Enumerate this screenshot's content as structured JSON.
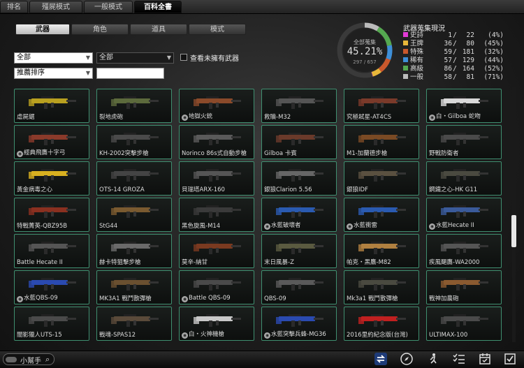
{
  "top_tabs": [
    "排名",
    "殭屍模式",
    "一般模式",
    "百科全書"
  ],
  "category_tabs": [
    "武器",
    "角色",
    "道具",
    "模式"
  ],
  "filters": {
    "type_select": "全部",
    "sub_select": "全部",
    "sort_select": "推薦排序",
    "search_placeholder": "",
    "show_unowned_label": "查看未擁有武器"
  },
  "collection": {
    "gauge_title": "全部蒐集",
    "percent_text": "45.21%",
    "count_text": "297 / 657",
    "percent_value": 0.4521,
    "stats_title": "武器蒐集現況",
    "rows": [
      {
        "label": "史詩",
        "owned": "1",
        "total": "22",
        "pct": "(4%)",
        "color": "#e23ad6"
      },
      {
        "label": "王牌",
        "owned": "36",
        "total": "80",
        "pct": "(45%)",
        "color": "#e8b73a"
      },
      {
        "label": "特殊",
        "owned": "59",
        "total": "181",
        "pct": "(32%)",
        "color": "#c9582c"
      },
      {
        "label": "稀有",
        "owned": "57",
        "total": "129",
        "pct": "(44%)",
        "color": "#3e8fd8"
      },
      {
        "label": "高級",
        "owned": "86",
        "total": "164",
        "pct": "(52%)",
        "color": "#55a850"
      },
      {
        "label": "一般",
        "owned": "58",
        "total": "81",
        "pct": "(71%)",
        "color": "#bbbbbb"
      }
    ]
  },
  "weapons": [
    {
      "name": "虐屍鋸",
      "badge": false,
      "color": "#b8a020"
    },
    {
      "name": "裂地虎砲",
      "badge": false,
      "color": "#5c6a3c"
    },
    {
      "name": "地獄火銃",
      "badge": true,
      "color": "#8a4a2a"
    },
    {
      "name": "救贖-M32",
      "badge": false,
      "color": "#555555"
    },
    {
      "name": "究極弒星-AT4CS",
      "badge": false,
      "color": "#7a3a2a"
    },
    {
      "name": "白・Gilboa 蛇吻",
      "badge": true,
      "color": "#d8d8d8"
    },
    {
      "name": "經典飛鷹十字弓",
      "badge": true,
      "color": "#8a3a2a"
    },
    {
      "name": "KH-2002突擊步槍",
      "badge": false,
      "color": "#4a4a4a"
    },
    {
      "name": "Norinco 86s式自動步槍",
      "badge": false,
      "color": "#5a5a5a"
    },
    {
      "name": "Gilboa 卡賓",
      "badge": false,
      "color": "#6a3a2a"
    },
    {
      "name": "M1-加蘭德步槍",
      "badge": false,
      "color": "#7a4a24"
    },
    {
      "name": "野戰防衛者",
      "badge": false,
      "color": "#4a4a4a"
    },
    {
      "name": "黃金病毒之心",
      "badge": false,
      "color": "#d8b020"
    },
    {
      "name": "OTS-14 GROZA",
      "badge": false,
      "color": "#444444"
    },
    {
      "name": "貝瑞塔ARX-160",
      "badge": false,
      "color": "#555555"
    },
    {
      "name": "銀狼Clarion 5.56",
      "badge": false,
      "color": "#666666"
    },
    {
      "name": "銀狼IDF",
      "badge": false,
      "color": "#5a5040"
    },
    {
      "name": "鋼鐵之心-HK G11",
      "badge": false,
      "color": "#4a4a40"
    },
    {
      "name": "特戰菁英-QBZ95B",
      "badge": false,
      "color": "#8a3020"
    },
    {
      "name": "StG44",
      "badge": false,
      "color": "#7a5a30"
    },
    {
      "name": "黑色旋風-M14",
      "badge": false,
      "color": "#3a3a3a"
    },
    {
      "name": "水藍破壞者",
      "badge": true,
      "color": "#2a5ab0"
    },
    {
      "name": "水藍衝雷",
      "badge": true,
      "color": "#2a5ab0"
    },
    {
      "name": "水藍Hecate II",
      "badge": true,
      "color": "#3a5a9a"
    },
    {
      "name": "Battle Hecate II",
      "badge": false,
      "color": "#555555"
    },
    {
      "name": "赫卡特狙擊步槍",
      "badge": false,
      "color": "#6a6a6a"
    },
    {
      "name": "莫辛-納甘",
      "badge": false,
      "color": "#7a3a20"
    },
    {
      "name": "末日風暴-Z",
      "badge": false,
      "color": "#5a5a40"
    },
    {
      "name": "帕克・黑鷹-M82",
      "badge": false,
      "color": "#b08040"
    },
    {
      "name": "疾風颶鷹-WA2000",
      "badge": false,
      "color": "#555555"
    },
    {
      "name": "水藍QBS-09",
      "badge": true,
      "color": "#2a4ab0"
    },
    {
      "name": "MK3A1 戰鬥散彈槍",
      "badge": false,
      "color": "#6a5030"
    },
    {
      "name": "Battle QBS-09",
      "badge": true,
      "color": "#4a4a4a"
    },
    {
      "name": "QBS-09",
      "badge": false,
      "color": "#5a5a5a"
    },
    {
      "name": "Mk3a1 戰鬥散彈槍",
      "badge": false,
      "color": "#4a4a40"
    },
    {
      "name": "戰神加農砲",
      "badge": false,
      "color": "#8a5a30"
    },
    {
      "name": "闇影獵人UTS-15",
      "badge": false,
      "color": "#4a4a4a"
    },
    {
      "name": "戰魂-SPAS12",
      "badge": false,
      "color": "#5a4a3a"
    },
    {
      "name": "白・火神機槍",
      "badge": true,
      "color": "#c8c8c8"
    },
    {
      "name": "水藍突擊兵蜂-MG36",
      "badge": true,
      "color": "#2a4ab0"
    },
    {
      "name": "2016里約紀念版(台灣)",
      "badge": false,
      "color": "#c02020"
    },
    {
      "name": "ULTIMAX-100",
      "badge": false,
      "color": "#4a4a4a"
    }
  ],
  "helper": {
    "label": "小幫手"
  },
  "bottom_icons": [
    "refresh-icon",
    "compass-icon",
    "run-icon",
    "checklist-icon",
    "calendar-icon",
    "check-box-icon"
  ]
}
